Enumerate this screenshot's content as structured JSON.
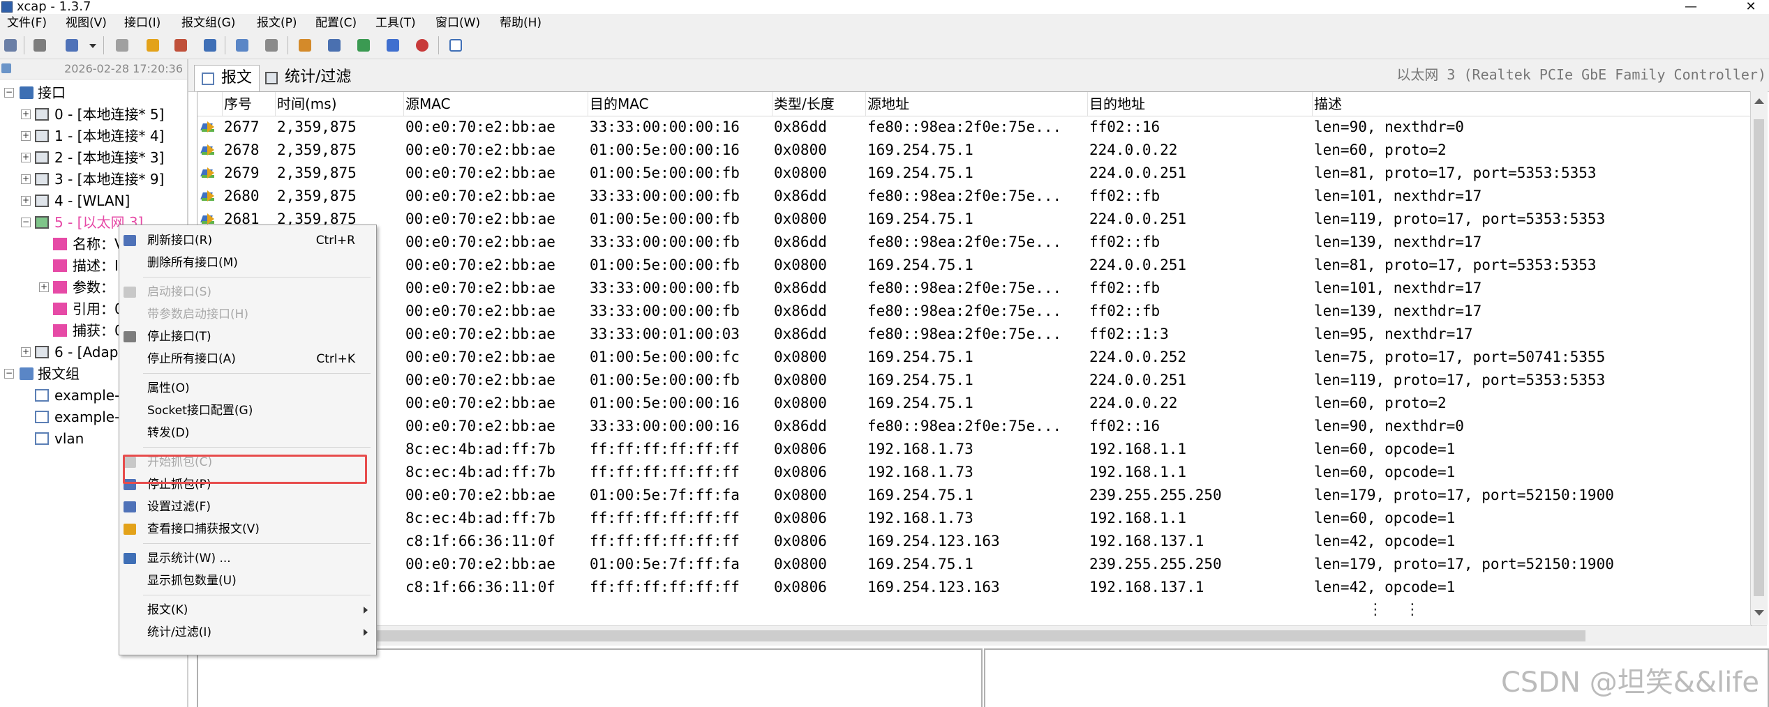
{
  "window": {
    "title": "xcap - 1.3.7",
    "minimize": "—",
    "close": "✕"
  },
  "menu": [
    "文件(F)",
    "视图(V)",
    "接口(I)",
    "报文组(G)",
    "报文(P)",
    "配置(C)",
    "工具(T)",
    "窗口(W)",
    "帮助(H)"
  ],
  "toolbar_icons": [
    "refresh-icon",
    "start-capture-icon",
    "capture-options-icon",
    "dropdown-icon",
    "stop-icon",
    "filter-icon",
    "export-icon",
    "book-icon",
    "window-icon",
    "window2-icon",
    "stats-icon",
    "columns-icon",
    "save-icon",
    "chart-icon",
    "pie-icon",
    "comment-icon"
  ],
  "left": {
    "timestamp": "2026-02-28 17:20:36",
    "root_label": "接口",
    "interfaces": [
      {
        "label": "0 - [本地连接* 5]"
      },
      {
        "label": "1 - [本地连接* 4]"
      },
      {
        "label": "2 - [本地连接* 3]"
      },
      {
        "label": "3 - [本地连接* 9]"
      },
      {
        "label": "4 - [WLAN]"
      },
      {
        "label": "5 - [以太网 3]"
      },
      {
        "label": "6 - [Adap"
      }
    ],
    "props": [
      {
        "label": "名称：V"
      },
      {
        "label": "描述：I"
      },
      {
        "label": "参数："
      },
      {
        "label": "引用：0"
      },
      {
        "label": "捕获：0"
      }
    ],
    "group_label": "报文组",
    "groups": [
      {
        "label": "example-"
      },
      {
        "label": "example-"
      },
      {
        "label": "vlan"
      }
    ]
  },
  "tabs": [
    {
      "label": "报文"
    },
    {
      "label": "统计/过滤"
    }
  ],
  "adapter_title": "以太网 3 (Realtek PCIe GbE Family Controller)",
  "table": {
    "columns": [
      "序号",
      "时间(ms)",
      "源MAC",
      "目的MAC",
      "类型/长度",
      "源地址",
      "目的地址",
      "描述"
    ],
    "rows": [
      [
        "2677",
        "2,359,875",
        "00:e0:70:e2:bb:ae",
        "33:33:00:00:00:16",
        "0x86dd",
        "fe80::98ea:2f0e:75e...",
        "ff02::16",
        "len=90, nexthdr=0"
      ],
      [
        "2678",
        "2,359,875",
        "00:e0:70:e2:bb:ae",
        "01:00:5e:00:00:16",
        "0x0800",
        "169.254.75.1",
        "224.0.0.22",
        "len=60, proto=2"
      ],
      [
        "2679",
        "2,359,875",
        "00:e0:70:e2:bb:ae",
        "01:00:5e:00:00:fb",
        "0x0800",
        "169.254.75.1",
        "224.0.0.251",
        "len=81, proto=17, port=5353:5353"
      ],
      [
        "2680",
        "2,359,875",
        "00:e0:70:e2:bb:ae",
        "33:33:00:00:00:fb",
        "0x86dd",
        "fe80::98ea:2f0e:75e...",
        "ff02::fb",
        "len=101, nexthdr=17"
      ],
      [
        "2681",
        "2,359,875",
        "00:e0:70:e2:bb:ae",
        "01:00:5e:00:00:fb",
        "0x0800",
        "169.254.75.1",
        "224.0.0.251",
        "len=119, proto=17, port=5353:5353"
      ],
      [
        "",
        "",
        "00:e0:70:e2:bb:ae",
        "33:33:00:00:00:fb",
        "0x86dd",
        "fe80::98ea:2f0e:75e...",
        "ff02::fb",
        "len=139, nexthdr=17"
      ],
      [
        "",
        "",
        "00:e0:70:e2:bb:ae",
        "01:00:5e:00:00:fb",
        "0x0800",
        "169.254.75.1",
        "224.0.0.251",
        "len=81, proto=17, port=5353:5353"
      ],
      [
        "",
        "",
        "00:e0:70:e2:bb:ae",
        "33:33:00:00:00:fb",
        "0x86dd",
        "fe80::98ea:2f0e:75e...",
        "ff02::fb",
        "len=101, nexthdr=17"
      ],
      [
        "",
        "",
        "00:e0:70:e2:bb:ae",
        "33:33:00:00:00:fb",
        "0x86dd",
        "fe80::98ea:2f0e:75e...",
        "ff02::fb",
        "len=139, nexthdr=17"
      ],
      [
        "",
        "",
        "00:e0:70:e2:bb:ae",
        "33:33:00:01:00:03",
        "0x86dd",
        "fe80::98ea:2f0e:75e...",
        "ff02::1:3",
        "len=95, nexthdr=17"
      ],
      [
        "",
        "",
        "00:e0:70:e2:bb:ae",
        "01:00:5e:00:00:fc",
        "0x0800",
        "169.254.75.1",
        "224.0.0.252",
        "len=75, proto=17, port=50741:5355"
      ],
      [
        "",
        "",
        "00:e0:70:e2:bb:ae",
        "01:00:5e:00:00:fb",
        "0x0800",
        "169.254.75.1",
        "224.0.0.251",
        "len=119, proto=17, port=5353:5353"
      ],
      [
        "",
        "",
        "00:e0:70:e2:bb:ae",
        "01:00:5e:00:00:16",
        "0x0800",
        "169.254.75.1",
        "224.0.0.22",
        "len=60, proto=2"
      ],
      [
        "",
        "",
        "00:e0:70:e2:bb:ae",
        "33:33:00:00:00:16",
        "0x86dd",
        "fe80::98ea:2f0e:75e...",
        "ff02::16",
        "len=90, nexthdr=0"
      ],
      [
        "",
        "",
        "8c:ec:4b:ad:ff:7b",
        "ff:ff:ff:ff:ff:ff",
        "0x0806",
        "192.168.1.73",
        "192.168.1.1",
        "len=60, opcode=1"
      ],
      [
        "",
        "",
        "8c:ec:4b:ad:ff:7b",
        "ff:ff:ff:ff:ff:ff",
        "0x0806",
        "192.168.1.73",
        "192.168.1.1",
        "len=60, opcode=1"
      ],
      [
        "",
        "",
        "00:e0:70:e2:bb:ae",
        "01:00:5e:7f:ff:fa",
        "0x0800",
        "169.254.75.1",
        "239.255.255.250",
        "len=179, proto=17, port=52150:1900"
      ],
      [
        "",
        "",
        "8c:ec:4b:ad:ff:7b",
        "ff:ff:ff:ff:ff:ff",
        "0x0806",
        "192.168.1.73",
        "192.168.1.1",
        "len=60, opcode=1"
      ],
      [
        "",
        "",
        "c8:1f:66:36:11:0f",
        "ff:ff:ff:ff:ff:ff",
        "0x0806",
        "169.254.123.163",
        "192.168.137.1",
        "len=42, opcode=1"
      ],
      [
        "",
        "",
        "00:e0:70:e2:bb:ae",
        "01:00:5e:7f:ff:fa",
        "0x0800",
        "169.254.75.1",
        "239.255.255.250",
        "len=179, proto=17, port=52150:1900"
      ],
      [
        "",
        "",
        "c8:1f:66:36:11:0f",
        "ff:ff:ff:ff:ff:ff",
        "0x0806",
        "169.254.123.163",
        "192.168.137.1",
        "len=42, opcode=1"
      ]
    ],
    "ellipsis": "⋮ ⋮"
  },
  "context_menu": {
    "items": [
      {
        "label": "刷新接口(R)",
        "shortcut": "Ctrl+R",
        "disabled": false,
        "icon": true,
        "submenu": false
      },
      {
        "label": "删除所有接口(M)",
        "shortcut": "",
        "disabled": false,
        "icon": false,
        "submenu": false
      },
      {
        "sep": true
      },
      {
        "label": "启动接口(S)",
        "shortcut": "",
        "disabled": true,
        "icon": true,
        "submenu": false
      },
      {
        "label": "带参数启动接口(H)",
        "shortcut": "",
        "disabled": true,
        "icon": false,
        "submenu": false
      },
      {
        "label": "停止接口(T)",
        "shortcut": "",
        "disabled": false,
        "icon": true,
        "submenu": false
      },
      {
        "label": "停止所有接口(A)",
        "shortcut": "Ctrl+K",
        "disabled": false,
        "icon": false,
        "submenu": false
      },
      {
        "sep": true
      },
      {
        "label": "属性(O)",
        "shortcut": "",
        "disabled": false,
        "icon": false,
        "submenu": false
      },
      {
        "label": "Socket接口配置(G)",
        "shortcut": "",
        "disabled": false,
        "icon": false,
        "submenu": false
      },
      {
        "label": "转发(D)",
        "shortcut": "",
        "disabled": false,
        "icon": false,
        "submenu": false
      },
      {
        "sep": true
      },
      {
        "label": "开始抓包(C)",
        "shortcut": "",
        "disabled": true,
        "icon": true,
        "submenu": false
      },
      {
        "label": "停止抓包(P)",
        "shortcut": "",
        "disabled": false,
        "icon": true,
        "submenu": false
      },
      {
        "label": "设置过滤(F)",
        "shortcut": "",
        "disabled": false,
        "icon": true,
        "submenu": false
      },
      {
        "label": "查看接口捕获报文(V)",
        "shortcut": "",
        "disabled": false,
        "icon": true,
        "submenu": false
      },
      {
        "sep": true
      },
      {
        "label": "显示统计(W) ...",
        "shortcut": "",
        "disabled": false,
        "icon": true,
        "submenu": false
      },
      {
        "label": "显示抓包数量(U)",
        "shortcut": "",
        "disabled": false,
        "icon": false,
        "submenu": false
      },
      {
        "sep": true
      },
      {
        "label": "报文(K)",
        "shortcut": "",
        "disabled": false,
        "icon": false,
        "submenu": true
      },
      {
        "label": "统计/过滤(I)",
        "shortcut": "",
        "disabled": false,
        "icon": false,
        "submenu": true
      }
    ]
  },
  "colors": {
    "highlight_box": "#e74c4c",
    "selected_interface": "#e64aa6",
    "disabled_text": "#a8a8a8"
  },
  "watermark": "CSDN @坦笑&&life"
}
